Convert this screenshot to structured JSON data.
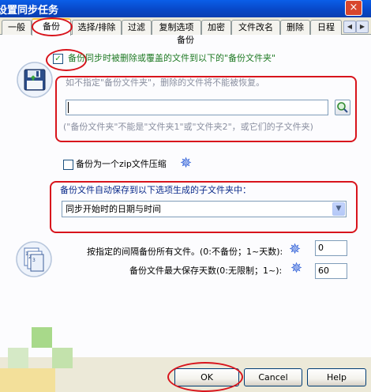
{
  "window": {
    "title": "设置同步任务",
    "close_label": "×"
  },
  "tabs": [
    {
      "label": "一般"
    },
    {
      "label": "备份"
    },
    {
      "label": "选择/排除"
    },
    {
      "label": "过滤"
    },
    {
      "label": "复制选项"
    },
    {
      "label": "加密"
    },
    {
      "label": "文件改名"
    },
    {
      "label": "删除"
    },
    {
      "label": "日程"
    }
  ],
  "tab_scroll": {
    "left": "◀",
    "right": "▶"
  },
  "panel": {
    "section_title": "备份",
    "backup_checkbox": {
      "label": "备份同步时被删除或覆盖的文件到以下的\"备份文件夹\"",
      "checked": true,
      "mark": "✓"
    },
    "warning_text": "如不指定\"备份文件夹\"，删除的文件将不能被恢复。",
    "folder_input": {
      "value": "",
      "placeholder": ""
    },
    "folder_note": "(\"备份文件夹\"不能是\"文件夹1\"或\"文件夹2\"，或它们的子文件夹)",
    "zip_checkbox": {
      "label": "备份为一个zip文件压缩",
      "checked": false
    },
    "subfolder_label": "备份文件自动保存到以下选项生成的子文件夹中：",
    "subfolder_select": {
      "value": "同步开始时的日期与时间",
      "arrow": "▼"
    },
    "interval_label": "按指定的间隔备份所有文件。(0:不备份；1~天数):",
    "interval_value": "0",
    "max_days_label": "备份文件最大保存天数(0:无限制；1~):",
    "max_days_value": "60",
    "spark_glyph": "✵"
  },
  "footer": {
    "ok_label": "OK",
    "cancel_label": "Cancel",
    "help_label": "Help"
  },
  "colors": {
    "title_bar": "#0a50d8",
    "annotation_red": "#d8141c",
    "dialog_bg": "#ece9d8",
    "panel_bg": "#fcfcfe",
    "accent_blue": "#2e5fd8"
  },
  "icons": [
    "floppy-disk-icon",
    "search-folder-icon",
    "documents-stack-icon",
    "sparkle-icon"
  ]
}
